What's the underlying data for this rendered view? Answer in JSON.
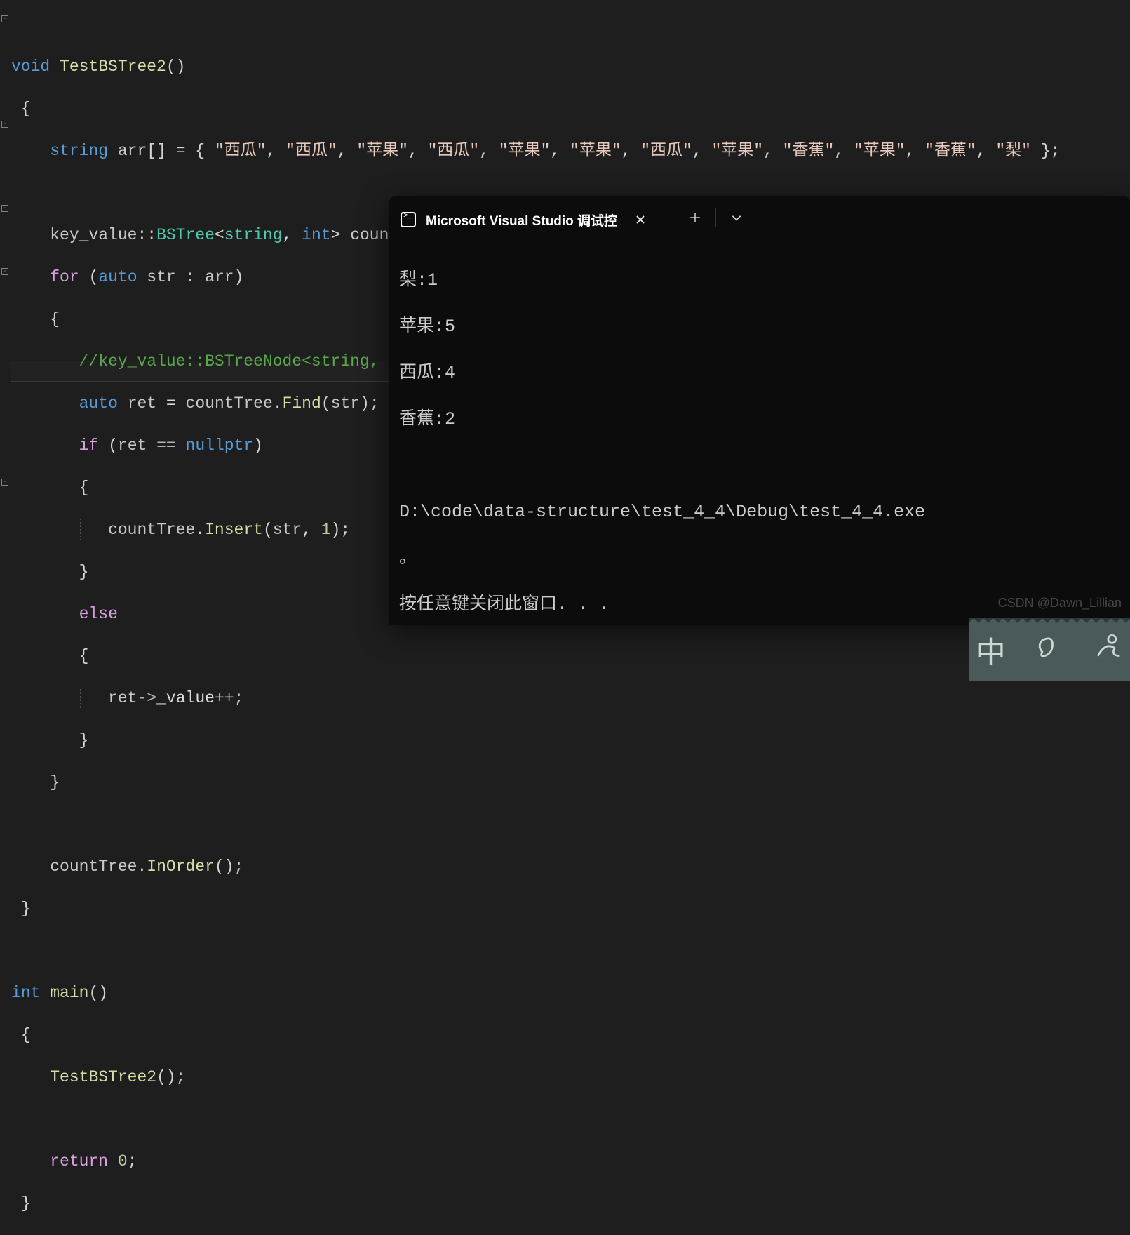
{
  "code": {
    "tokens": {
      "void": "void",
      "fn_test": "TestBSTree2",
      "string_t": "string",
      "arr": "arr",
      "strings": [
        "\"西瓜\"",
        "\"西瓜\"",
        "\"苹果\"",
        "\"西瓜\"",
        "\"苹果\"",
        "\"苹果\"",
        "\"西瓜\"",
        "\"苹果\"",
        "\"香蕉\"",
        "\"苹果\"",
        "\"香蕉\"",
        "\"梨\""
      ],
      "ns": "key_value",
      "bstree": "BSTree",
      "int_t": "int",
      "count_tree": "countTree",
      "for": "for",
      "auto": "auto",
      "str": "str",
      "comment": "//key_value::BSTreeNode<string, int>* ret = countTree.Find(str);",
      "ret": "ret",
      "find": "Find",
      "if": "if",
      "nullptr": "nullptr",
      "insert": "Insert",
      "one": "1",
      "else": "else",
      "value": "_value",
      "inorder": "InOrder",
      "int_kw": "int",
      "main": "main",
      "return": "return",
      "zero": "0"
    }
  },
  "terminal": {
    "tab_title": "Microsoft Visual Studio 调试控",
    "output": {
      "line1": "梨:1",
      "line2": "苹果:5",
      "line3": "西瓜:4",
      "line4": "香蕉:2",
      "blank": "",
      "path": "D:\\code\\data-structure\\test_4_4\\Debug\\test_4_4.exe",
      "dot": "。",
      "prompt": "按任意键关闭此窗口. . ."
    }
  },
  "watermark": "CSDN @Dawn_Lillian",
  "ime": {
    "char": "中"
  }
}
